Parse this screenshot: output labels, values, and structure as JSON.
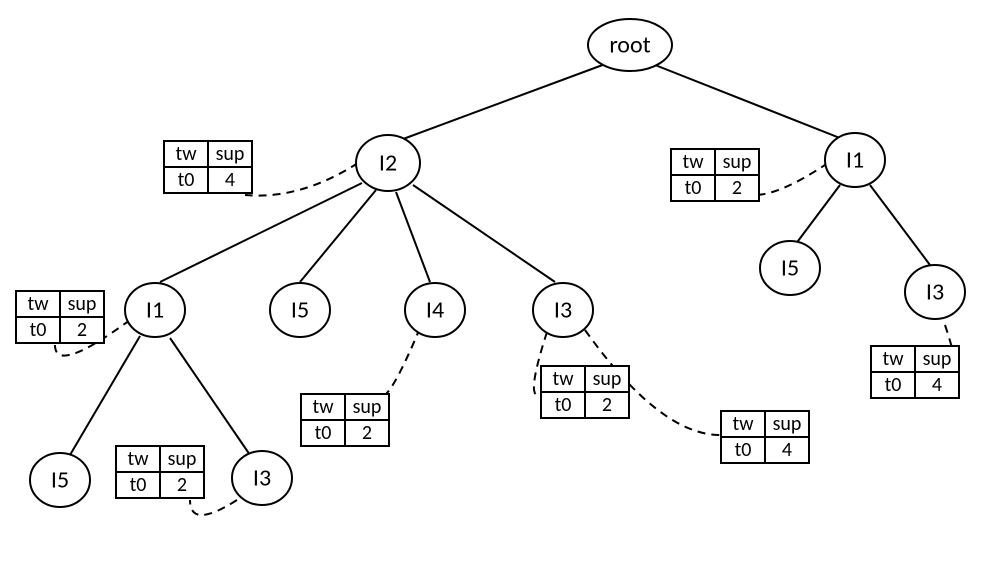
{
  "chart_data": {
    "type": "tree",
    "title": "",
    "nodes": [
      {
        "id": "root",
        "label": "root",
        "parent": null
      },
      {
        "id": "I2",
        "label": "I2",
        "parent": "root"
      },
      {
        "id": "I1r",
        "label": "I1",
        "parent": "root"
      },
      {
        "id": "I1l",
        "label": "I1",
        "parent": "I2"
      },
      {
        "id": "I5b",
        "label": "I5",
        "parent": "I2"
      },
      {
        "id": "I4",
        "label": "I4",
        "parent": "I2"
      },
      {
        "id": "I3b",
        "label": "I3",
        "parent": "I2"
      },
      {
        "id": "I5r",
        "label": "I5",
        "parent": "I1r"
      },
      {
        "id": "I3r",
        "label": "I3",
        "parent": "I1r"
      },
      {
        "id": "I5ll",
        "label": "I5",
        "parent": "I1l"
      },
      {
        "id": "I3ll",
        "label": "I3",
        "parent": "I1l"
      }
    ],
    "table_headers": {
      "col1": "tw",
      "col2": "sup"
    },
    "annotations": [
      {
        "attached_to": "I2",
        "tw": "t0",
        "sup": "4"
      },
      {
        "attached_to": "I1r",
        "tw": "t0",
        "sup": "2"
      },
      {
        "attached_to": "I1l",
        "tw": "t0",
        "sup": "2"
      },
      {
        "attached_to": "I4",
        "tw": "t0",
        "sup": "2"
      },
      {
        "attached_to": "I3b",
        "tw": "t0",
        "sup": "2"
      },
      {
        "attached_to": "I3r",
        "tw": "t0",
        "sup": "4"
      },
      {
        "attached_to": "I3ll",
        "tw": "t0",
        "sup": "2"
      },
      {
        "attached_to": "I3b_extra",
        "tw": "t0",
        "sup": "4"
      }
    ]
  }
}
